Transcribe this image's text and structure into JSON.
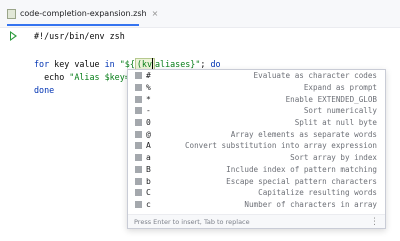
{
  "tab": {
    "label": "code-completion-expansion.zsh",
    "close": "×"
  },
  "code": {
    "line1": "#!/usr/bin/env zsh",
    "line2_kw1": "for",
    "line2_a": " key value ",
    "line2_kw2": "in",
    "line2_str1": " \"${",
    "line2_hl": "(kv",
    "line2_str2": "aliases}\"",
    "line2_b": "; ",
    "line2_kw3": "do",
    "line3_a": "  echo ",
    "line3_str": "\"Alias $key=$",
    "line4": "done"
  },
  "popup": {
    "items": [
      {
        "sym": "#",
        "desc": "Evaluate as character codes"
      },
      {
        "sym": "%",
        "desc": "Expand as prompt"
      },
      {
        "sym": "*",
        "desc": "Enable EXTENDED_GLOB"
      },
      {
        "sym": "-",
        "desc": "Sort numerically"
      },
      {
        "sym": "0",
        "desc": "Split at null byte"
      },
      {
        "sym": "@",
        "desc": "Array elements as separate words"
      },
      {
        "sym": "A",
        "desc": "Convert substitution into array expression"
      },
      {
        "sym": "a",
        "desc": "Sort array by index"
      },
      {
        "sym": "B",
        "desc": "Include index of pattern matching"
      },
      {
        "sym": "b",
        "desc": "Escape special pattern characters"
      },
      {
        "sym": "C",
        "desc": "Capitalize resulting words"
      },
      {
        "sym": "c",
        "desc": "Number of characters in array"
      }
    ],
    "footer": "Press Enter to insert, Tab to replace",
    "more": "⋮"
  }
}
